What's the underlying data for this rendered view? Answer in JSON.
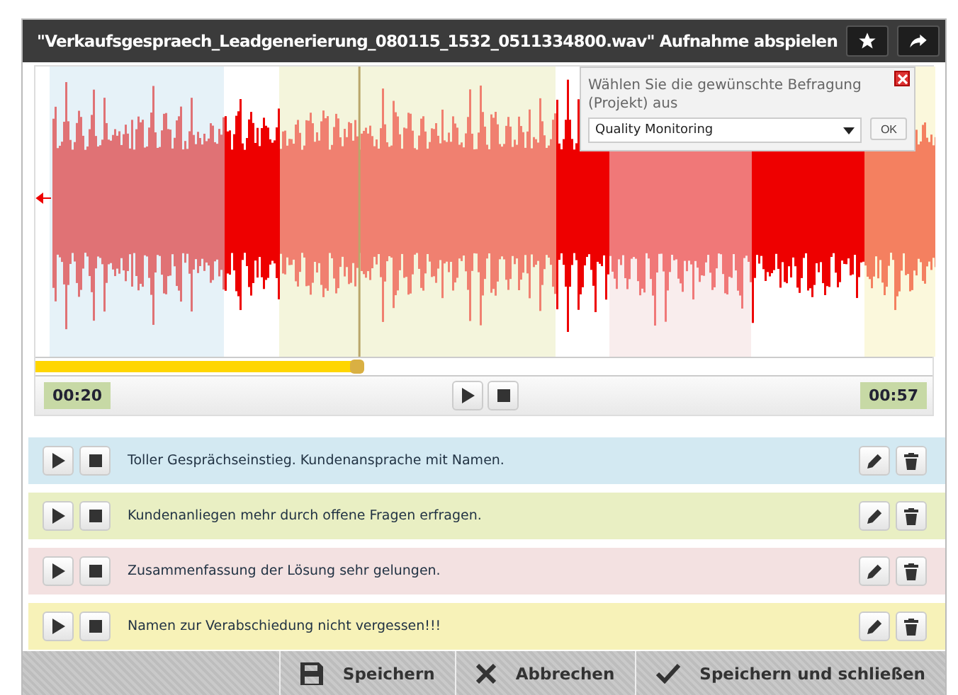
{
  "window": {
    "title": "\"Verkaufsgespraech_Leadgenerierung_080115_1532_0511334800.wav\" Aufnahme abspielen"
  },
  "survey_popup": {
    "prompt": "Wählen Sie die gewünschte Befragung (Projekt) aus",
    "select_value": "Quality Monitoring",
    "ok_label": "OK"
  },
  "player": {
    "level": 0.36,
    "elapsed": "00:20",
    "total": "00:57"
  },
  "comments": [
    {
      "text": "Toller Gesprächseinstieg. Kundenansprache mit Namen.",
      "color": "#d3e9f2"
    },
    {
      "text": "Kundenanliegen mehr durch offene Fragen erfragen.",
      "color": "#e9efc3"
    },
    {
      "text": "Zusammenfassung der Lösung sehr gelungen.",
      "color": "#f3e1e1"
    },
    {
      "text": "Namen zur Verabschiedung nicht vergessen!!!",
      "color": "#f7f2b8"
    }
  ],
  "footer_buttons": [
    {
      "label": "Speichern",
      "kind": "save"
    },
    {
      "label": "Abbrechen",
      "kind": "cancel"
    },
    {
      "label": "Speichern und schließen",
      "kind": "confirm"
    }
  ]
}
